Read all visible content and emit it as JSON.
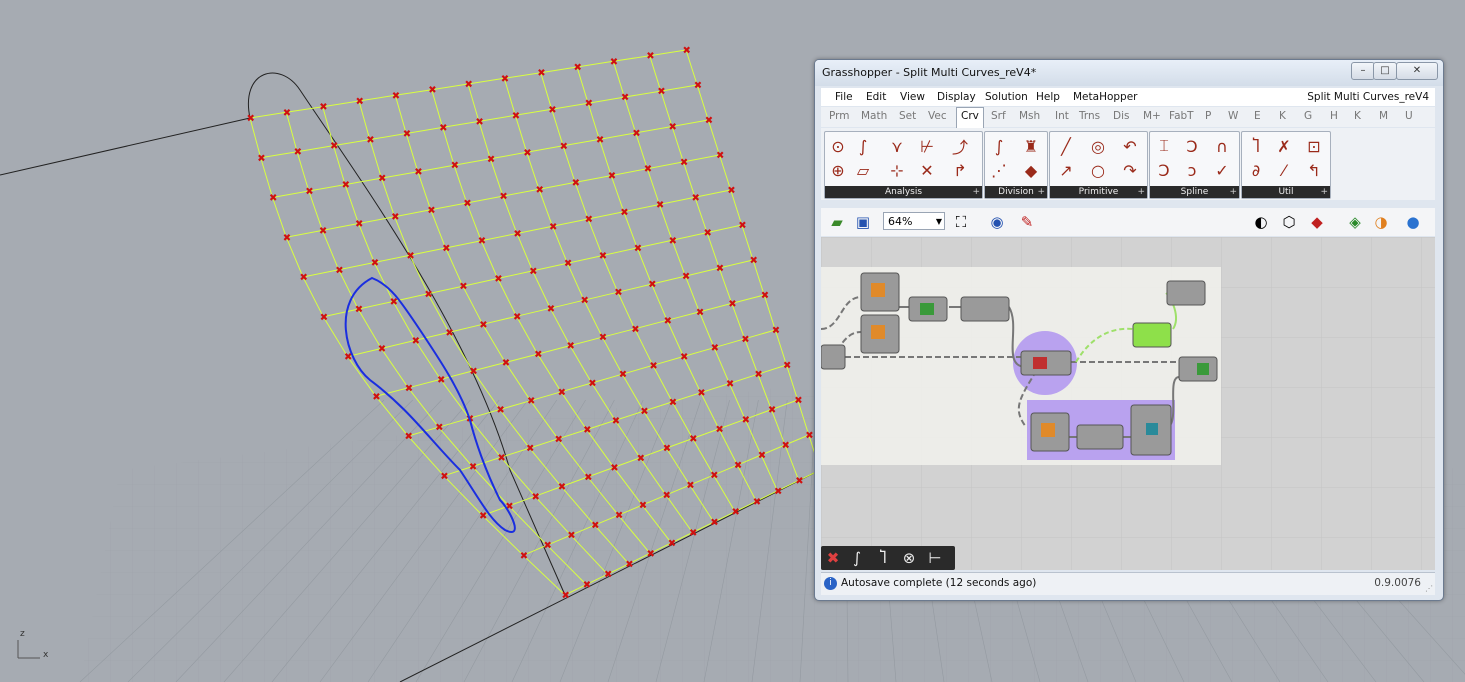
{
  "viewport": {
    "axis_x": "x",
    "axis_z": "z"
  },
  "gh_window": {
    "title": "Grasshopper - Split Multi Curves_reV4*",
    "doc_name": "Split Multi Curves_reV4",
    "controls": {
      "minimize": "–",
      "maximize": "□",
      "close": "✕"
    },
    "menu": [
      "File",
      "Edit",
      "View",
      "Display",
      "Solution",
      "Help",
      "MetaHopper"
    ],
    "tabs": [
      "Prm",
      "Math",
      "Set",
      "Vec",
      "Crv",
      "Srf",
      "Msh",
      "Int",
      "Trns",
      "Dis",
      "M+",
      "FabT",
      "P",
      "W",
      "E",
      "K",
      "G",
      "H",
      "K",
      "M",
      "U"
    ],
    "active_tab": "Crv",
    "panels": [
      "Analysis",
      "Division",
      "Primitive",
      "Spline",
      "Util"
    ],
    "zoom": "64%",
    "status": "Autosave complete (12 seconds ago)",
    "version": "0.9.0076",
    "colors": {
      "accent_purple": "#b9a2ef",
      "active_green": "#8ee04a",
      "canvas": "#d2d2d2"
    }
  }
}
